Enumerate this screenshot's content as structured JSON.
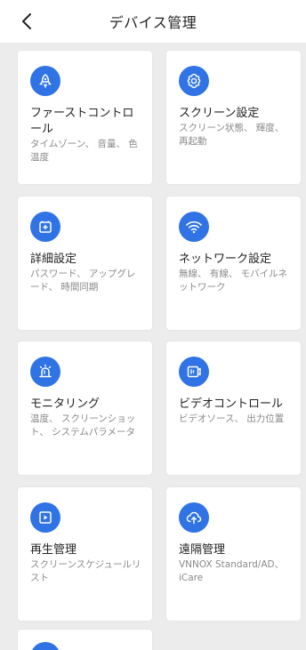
{
  "header": {
    "title": "デバイス管理"
  },
  "cards": [
    {
      "name": "ファーストコントロール",
      "desc": "タイムゾーン、 音量、 色温度",
      "icon": "rocket-icon"
    },
    {
      "name": "スクリーン設定",
      "desc": "スクリーン状態、 輝度、 再起動",
      "icon": "gear-icon"
    },
    {
      "name": "詳細設定",
      "desc": "パスワード、 アップグレード、 時間同期",
      "icon": "battery-plus-icon"
    },
    {
      "name": "ネットワーク設定",
      "desc": "無線、 有線、 モバイルネットワーク",
      "icon": "wifi-icon"
    },
    {
      "name": "モニタリング",
      "desc": "温度、 スクリーンショット、 システムパラメータ",
      "icon": "alarm-icon"
    },
    {
      "name": "ビデオコントロール",
      "desc": "ビデオソース、 出力位置",
      "icon": "video-icon"
    },
    {
      "name": "再生管理",
      "desc": "スクリーンスケジュールリスト",
      "icon": "play-icon"
    },
    {
      "name": "遠隔管理",
      "desc": "VNNOX Standard/AD、 iCare",
      "icon": "cloud-upload-icon"
    }
  ],
  "colors": {
    "accent": "#2f73e5",
    "background": "#ececec"
  }
}
